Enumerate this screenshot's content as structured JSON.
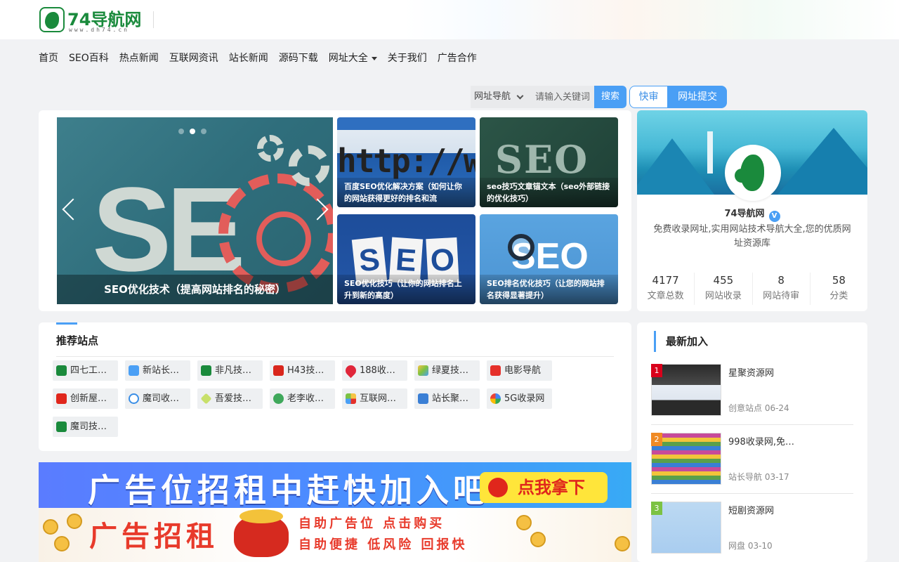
{
  "header": {
    "logo_text": "74导航网",
    "logo_sub": "www.dh74.cn"
  },
  "nav": {
    "items": [
      {
        "label": "首页"
      },
      {
        "label": "SEO百科"
      },
      {
        "label": "热点新闻"
      },
      {
        "label": "互联网资讯"
      },
      {
        "label": "站长新闻"
      },
      {
        "label": "源码下载"
      },
      {
        "label": "网址大全"
      },
      {
        "label": "关于我们"
      },
      {
        "label": "广告合作"
      }
    ]
  },
  "search": {
    "select_value": "网址导航",
    "placeholder": "请输入关键词",
    "button": "搜索"
  },
  "actions": {
    "fast_review": "快审",
    "submit_site": "网址提交"
  },
  "slider": {
    "main_caption": "SEO优化技术（提高网站排名的秘密）",
    "thumbs": [
      {
        "caption": "百度SEO优化解决方案（如何让你的网站获得更好的排名和流"
      },
      {
        "caption": "seo技巧文章锚文本（seo外部链接的优化技巧）"
      },
      {
        "caption": "SEO优化技巧（让你的网站排名上升到新的高度）"
      },
      {
        "caption": "SEO排名优化技巧（让您的网站排名获得显著提升）"
      }
    ]
  },
  "profile": {
    "name": "74导航网",
    "verified_mark": "V",
    "description": "免费收录网址,实用网站技术导航大全,您的优质网址资源库",
    "stats": [
      {
        "value": "4177",
        "label": "文章总数"
      },
      {
        "value": "455",
        "label": "网站收录"
      },
      {
        "value": "8",
        "label": "网站待审"
      },
      {
        "value": "58",
        "label": "分类"
      }
    ]
  },
  "recommended": {
    "title": "推荐站点",
    "sites": [
      {
        "label": "四七工…",
        "icon": "green-leaf-icon"
      },
      {
        "label": "新站长…",
        "icon": "blue-square-icon"
      },
      {
        "label": "非凡技…",
        "icon": "green-leaf-icon"
      },
      {
        "label": "H43技…",
        "icon": "red-h-icon"
      },
      {
        "label": "188收…",
        "icon": "heart-icon"
      },
      {
        "label": "绿夏技…",
        "icon": "colorful-icon"
      },
      {
        "label": "电影导航",
        "icon": "play-icon"
      },
      {
        "label": "创新屋…",
        "icon": "red-box-icon"
      },
      {
        "label": "魔司收…",
        "icon": "circle-arrows-icon"
      },
      {
        "label": "吾爱技…",
        "icon": "diamond-icon"
      },
      {
        "label": "老李收…",
        "icon": "person-icon"
      },
      {
        "label": "互联网…",
        "icon": "pinwheel-icon"
      },
      {
        "label": "站长聚…",
        "icon": "blue-nav-icon"
      },
      {
        "label": "5G收录网",
        "icon": "google-icon"
      },
      {
        "label": "魔司技…",
        "icon": "green-leaf-icon"
      }
    ]
  },
  "ads": {
    "banner1_text": "广告位招租中赶快加入吧",
    "banner1_button": "点我拿下",
    "banner2_main": "广告招租",
    "banner2_line1": "自助广告位 点击购买",
    "banner2_line2": "自助便捷 低风险 回报快"
  },
  "latest": {
    "title": "最新加入",
    "items": [
      {
        "rank": "1",
        "title": "星聚资源网",
        "meta": "创意站点 06-24",
        "badge_color": "#d9001b"
      },
      {
        "rank": "2",
        "title": "998收录网,免…",
        "meta": "站长导航 03-17",
        "badge_color": "#f08a24"
      },
      {
        "rank": "3",
        "title": "短剧资源网",
        "meta": "网盘 03-10",
        "badge_color": "#7cc243"
      }
    ]
  },
  "colors": {
    "accent": "#4a9ff5",
    "brand_green": "#1a8a3c"
  }
}
